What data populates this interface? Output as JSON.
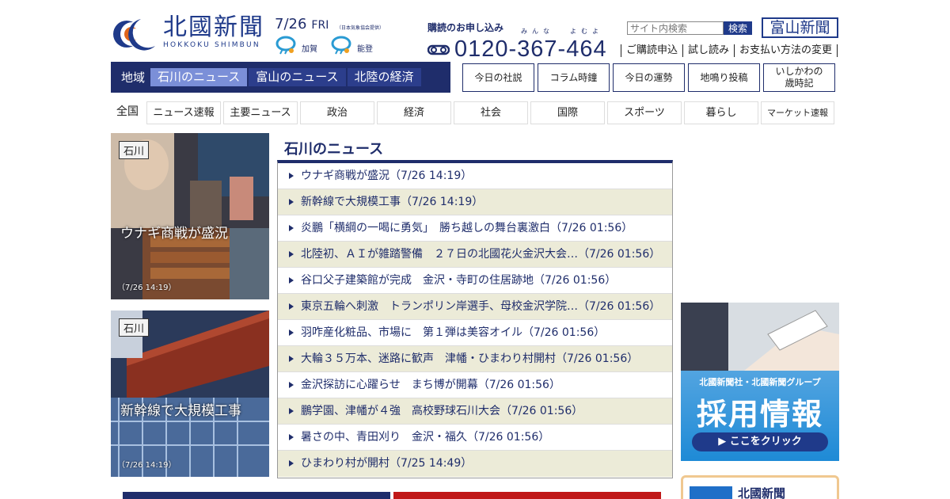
{
  "header": {
    "logo_jp": "北國新聞",
    "logo_en": "HOKKOKU SHIMBUN",
    "date": "7/26",
    "day_of_week": "FRI",
    "weather_note_prefix": "（日本気象協会",
    "weather_note_link": "提供",
    "weather_note_suffix": "）",
    "weather": [
      {
        "area": "加賀",
        "icon": "rain-cloud-icon"
      },
      {
        "area": "能登",
        "icon": "rain-cloud-icon"
      }
    ],
    "subscription_title": "購読のお申し込み",
    "phone_ruby_1": "みんな",
    "phone_ruby_2": "よむよ",
    "phone_number": "0120-367-464",
    "search_placeholder": "サイト内検索",
    "search_button": "検索",
    "toyama_link": "富山新聞",
    "util_links": [
      "ご購読申込",
      "試し読み",
      "お支払い方法の変更"
    ]
  },
  "main_nav": {
    "label": "地域",
    "items": [
      {
        "label": "石川のニュース",
        "active": true
      },
      {
        "label": "富山のニュース",
        "active": false
      },
      {
        "label": "北陸の経済",
        "active": false
      }
    ]
  },
  "box_buttons": [
    "今日の社説",
    "コラム時鐘",
    "今日の運勢",
    "地鳴り投稿",
    "いしかわの\n歳時記"
  ],
  "categories": [
    "全国",
    "ニュース速報",
    "主要ニュース",
    "政治",
    "経済",
    "社会",
    "国際",
    "スポーツ",
    "暮らし",
    "マーケット速報"
  ],
  "photos": [
    {
      "tag": "石川",
      "caption": "ウナギ商戦が盛況",
      "time": "（7/26 14:19）"
    },
    {
      "tag": "石川",
      "caption": "新幹線で大規模工事",
      "time": "（7/26 14:19）"
    }
  ],
  "news": {
    "title": "石川のニュース",
    "items": [
      "ウナギ商戦が盛況（7/26 14:19）",
      "新幹線で大規模工事（7/26 14:19）",
      "炎鵬「横綱の一喝に勇気」　勝ち越しの舞台裏激白（7/26 01:56）",
      "北陸初、ＡＩが雑踏警備　２７日の北國花火金沢大会…（7/26 01:56）",
      "谷口父子建築館が完成　金沢・寺町の住居跡地（7/26 01:56）",
      "東京五輪へ刺激　トランポリン岸選手、母校金沢学院…（7/26 01:56）",
      "羽咋産化粧品、市場に　第１弾は美容オイル（7/26 01:56）",
      "大輪３５万本、迷路に歓声　津幡・ひまわり村開村（7/26 01:56）",
      "金沢探訪に心躍らせ　まち博が開幕（7/26 01:56）",
      "鵬学園、津幡が４強　高校野球石川大会（7/26 01:56）",
      "暑さの中、青田刈り　金沢・福久（7/26 01:56）",
      "ひまわり村が開村（7/25 14:49）"
    ]
  },
  "ad": {
    "subtitle": "北國新聞社・北國新聞グループ",
    "title": "採用情報",
    "button": "▶ ここをクリック"
  },
  "promo": {
    "title": "北國新聞"
  }
}
